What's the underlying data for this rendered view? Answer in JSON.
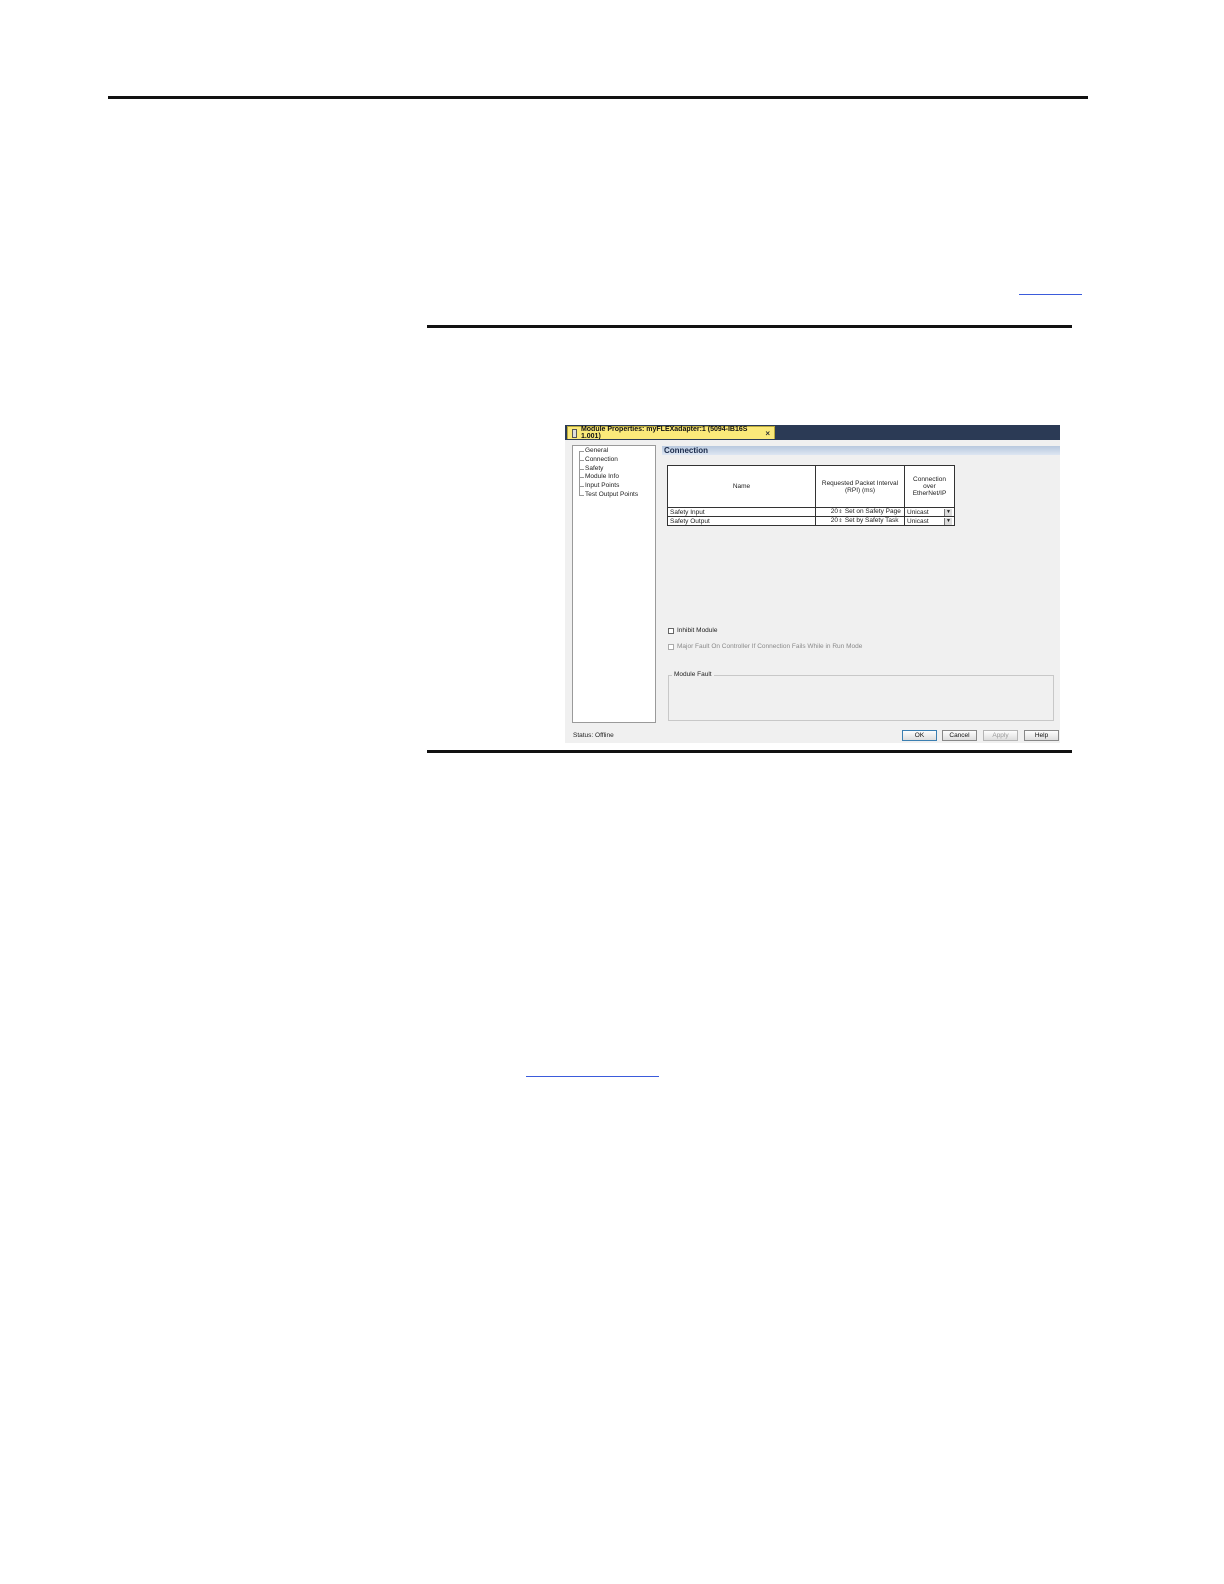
{
  "window": {
    "title": "Module Properties: myFLEXadapter:1 (5094-IB16S 1.001)",
    "close_glyph": "×"
  },
  "nav": {
    "items": [
      {
        "label": "General"
      },
      {
        "label": "Connection"
      },
      {
        "label": "Safety"
      },
      {
        "label": "Module Info"
      },
      {
        "label": "Input Points"
      },
      {
        "label": "Test Output Points"
      }
    ]
  },
  "connection": {
    "section_title": "Connection",
    "headers": {
      "name": "Name",
      "rpi": "Requested Packet Interval (RPI) (ms)",
      "conn": "Connection over EtherNet/IP"
    },
    "rows": [
      {
        "name": "Safety Input",
        "rpi": "20",
        "rpi_note": "Set on Safety Page",
        "conn": "Unicast"
      },
      {
        "name": "Safety Output",
        "rpi": "20",
        "rpi_note": "Set by Safety Task",
        "conn": "Unicast"
      }
    ]
  },
  "options": {
    "inhibit": "Inhibit Module",
    "major_fault": "Major Fault On Controller If Connection Fails While in Run Mode"
  },
  "fault": {
    "label": "Module Fault"
  },
  "status": {
    "text": "Status:  Offline"
  },
  "buttons": {
    "ok": "OK",
    "cancel": "Cancel",
    "apply": "Apply",
    "help": "Help"
  }
}
